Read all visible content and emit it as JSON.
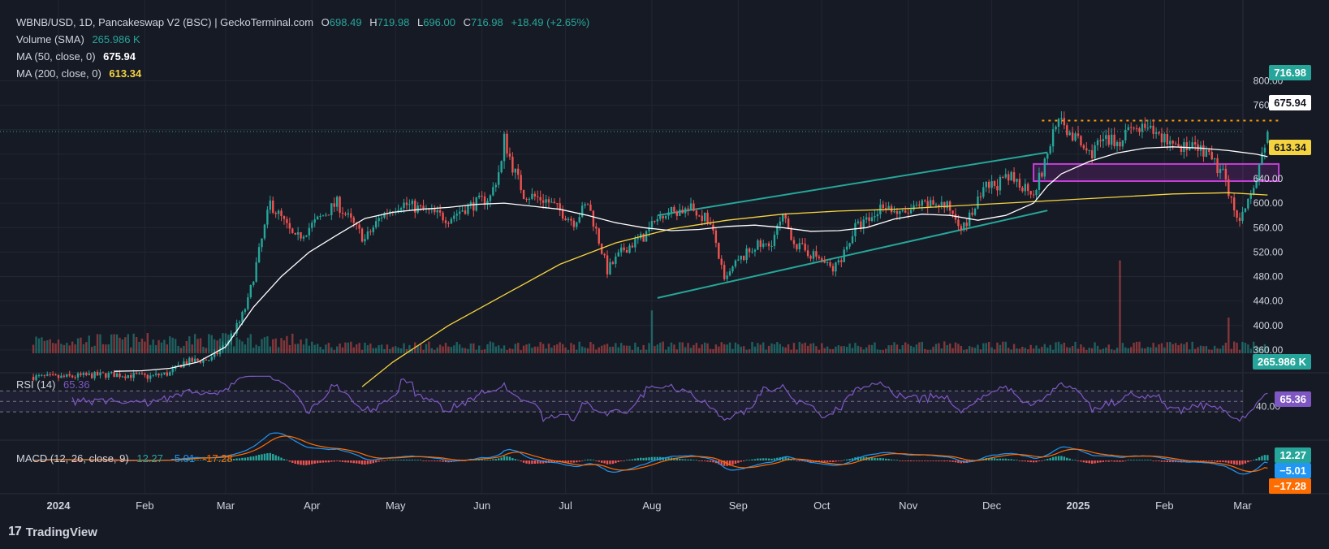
{
  "header": {
    "symbol": "WBNB/USD, 1D, Pancakeswap V2 (BSC) | GeckoTerminal.com",
    "o_label": "O",
    "o": "698.49",
    "h_label": "H",
    "h": "719.98",
    "l_label": "L",
    "l": "696.00",
    "c_label": "C",
    "c": "716.98",
    "change": "+18.49 (+2.65%)"
  },
  "legend": {
    "volume_label": "Volume (SMA)",
    "volume_value": "265.986 K",
    "ma50_label": "MA (50, close, 0)",
    "ma50_value": "675.94",
    "ma200_label": "MA (200, close, 0)",
    "ma200_value": "613.34",
    "rsi_label": "RSI (14)",
    "rsi_value": "65.36",
    "macd_label": "MACD (12, 26, close, 9)",
    "macd_v1": "12.27",
    "macd_v2": "-5.01",
    "macd_v3": "-17.28"
  },
  "tags": {
    "price": "716.98",
    "ma50": "675.94",
    "ma200": "613.34",
    "volume": "265.986 K",
    "rsi": "65.36",
    "macd_hist": "12.27",
    "macd_line": "−5.01",
    "macd_signal": "−17.28"
  },
  "colors": {
    "up": "#26a69a",
    "down": "#ef5350",
    "ma50": "#ffffff",
    "ma200": "#f5d33f",
    "channel": "#26a69a",
    "zone": "#c43fd6",
    "resistance": "#ff9800",
    "rsi": "#7e57c2",
    "macd": "#2196f3",
    "signal": "#ff6d00"
  },
  "footer": {
    "brand": "TradingView"
  },
  "chart_data": {
    "type": "candlestick",
    "title": "WBNB/USD, 1D",
    "x_labels": [
      "2024",
      "Feb",
      "Mar",
      "Apr",
      "May",
      "Jun",
      "Jul",
      "Aug",
      "Sep",
      "Oct",
      "Nov",
      "Dec",
      "2025",
      "Feb",
      "Mar"
    ],
    "x_label_days": [
      0,
      31,
      60,
      91,
      121,
      152,
      182,
      213,
      244,
      274,
      305,
      335,
      366,
      397,
      425
    ],
    "y_ticks": [
      360,
      400,
      440,
      480,
      520,
      560,
      600,
      640,
      680,
      720,
      760,
      800
    ],
    "y_tick_labels": [
      "360.00",
      "400.00",
      "440.00",
      "480.00",
      "520.00",
      "560.00",
      "600.00",
      "640.00",
      "675.94",
      "716.98",
      "760.00",
      "800.00"
    ],
    "ylim": [
      324,
      802
    ],
    "price_path": [
      [
        -9,
        316
      ],
      [
        0,
        315
      ],
      [
        10,
        318
      ],
      [
        20,
        320
      ],
      [
        28,
        318
      ],
      [
        32,
        316
      ],
      [
        40,
        322
      ],
      [
        45,
        340
      ],
      [
        55,
        345
      ],
      [
        60,
        370
      ],
      [
        65,
        405
      ],
      [
        68,
        440
      ],
      [
        72,
        520
      ],
      [
        76,
        600
      ],
      [
        80,
        575
      ],
      [
        85,
        540
      ],
      [
        90,
        560
      ],
      [
        100,
        600
      ],
      [
        110,
        540
      ],
      [
        116,
        580
      ],
      [
        123,
        600
      ],
      [
        130,
        590
      ],
      [
        140,
        575
      ],
      [
        145,
        590
      ],
      [
        150,
        600
      ],
      [
        155,
        610
      ],
      [
        159,
        665
      ],
      [
        160,
        705
      ],
      [
        163,
        660
      ],
      [
        167,
        615
      ],
      [
        175,
        605
      ],
      [
        185,
        570
      ],
      [
        190,
        600
      ],
      [
        193,
        555
      ],
      [
        197,
        490
      ],
      [
        203,
        525
      ],
      [
        210,
        545
      ],
      [
        217,
        585
      ],
      [
        227,
        590
      ],
      [
        233,
        575
      ],
      [
        236,
        535
      ],
      [
        239,
        470
      ],
      [
        243,
        500
      ],
      [
        250,
        530
      ],
      [
        255,
        530
      ],
      [
        260,
        575
      ],
      [
        265,
        530
      ],
      [
        273,
        510
      ],
      [
        278,
        490
      ],
      [
        282,
        520
      ],
      [
        286,
        560
      ],
      [
        292,
        575
      ],
      [
        296,
        600
      ],
      [
        302,
        580
      ],
      [
        310,
        595
      ],
      [
        316,
        600
      ],
      [
        320,
        590
      ],
      [
        325,
        560
      ],
      [
        328,
        585
      ],
      [
        333,
        625
      ],
      [
        342,
        640
      ],
      [
        350,
        620
      ],
      [
        353,
        650
      ],
      [
        355,
        680
      ],
      [
        358,
        735
      ],
      [
        362,
        720
      ],
      [
        366,
        700
      ],
      [
        370,
        680
      ],
      [
        374,
        700
      ],
      [
        380,
        700
      ],
      [
        385,
        720
      ],
      [
        390,
        720
      ],
      [
        395,
        710
      ],
      [
        400,
        700
      ],
      [
        405,
        690
      ],
      [
        410,
        685
      ],
      [
        415,
        665
      ],
      [
        418,
        645
      ],
      [
        421,
        610
      ],
      [
        423,
        570
      ],
      [
        426,
        585
      ],
      [
        430,
        640
      ],
      [
        432,
        680
      ],
      [
        434,
        716.98
      ]
    ],
    "ma50_path": [
      [
        20,
        325
      ],
      [
        30,
        326
      ],
      [
        40,
        330
      ],
      [
        50,
        340
      ],
      [
        60,
        365
      ],
      [
        70,
        430
      ],
      [
        80,
        480
      ],
      [
        90,
        520
      ],
      [
        100,
        548
      ],
      [
        110,
        575
      ],
      [
        120,
        585
      ],
      [
        130,
        590
      ],
      [
        140,
        593
      ],
      [
        150,
        598
      ],
      [
        160,
        600
      ],
      [
        170,
        595
      ],
      [
        180,
        590
      ],
      [
        190,
        580
      ],
      [
        200,
        568
      ],
      [
        210,
        560
      ],
      [
        220,
        555
      ],
      [
        230,
        557
      ],
      [
        240,
        562
      ],
      [
        250,
        564
      ],
      [
        260,
        560
      ],
      [
        270,
        554
      ],
      [
        280,
        555
      ],
      [
        290,
        560
      ],
      [
        300,
        574
      ],
      [
        310,
        582
      ],
      [
        320,
        580
      ],
      [
        330,
        572
      ],
      [
        340,
        580
      ],
      [
        350,
        600
      ],
      [
        355,
        628
      ],
      [
        360,
        648
      ],
      [
        370,
        668
      ],
      [
        380,
        682
      ],
      [
        390,
        690
      ],
      [
        400,
        692
      ],
      [
        410,
        690
      ],
      [
        420,
        686
      ],
      [
        430,
        680
      ],
      [
        434,
        675.94
      ]
    ],
    "ma200_path": [
      [
        109,
        300
      ],
      [
        120,
        340
      ],
      [
        140,
        400
      ],
      [
        160,
        450
      ],
      [
        180,
        500
      ],
      [
        200,
        535
      ],
      [
        220,
        558
      ],
      [
        240,
        572
      ],
      [
        260,
        582
      ],
      [
        280,
        587
      ],
      [
        300,
        590
      ],
      [
        320,
        595
      ],
      [
        340,
        600
      ],
      [
        360,
        605
      ],
      [
        380,
        610
      ],
      [
        400,
        615
      ],
      [
        420,
        617
      ],
      [
        434,
        613.34
      ]
    ],
    "channel_upper": [
      [
        215,
        580
      ],
      [
        355,
        683
      ]
    ],
    "channel_lower": [
      [
        215,
        445
      ],
      [
        355,
        588
      ]
    ],
    "zone": {
      "x0": 350,
      "x1": 438,
      "y0": 636,
      "y1": 664
    },
    "resistance": {
      "x0": 353,
      "x1": 438,
      "y": 735
    },
    "volume_spikes": [
      {
        "day": 381,
        "value": 5.2
      },
      {
        "day": 213,
        "value": 2.4
      },
      {
        "day": 420,
        "value": 2.0
      }
    ],
    "rsi": {
      "range": [
        10,
        100
      ],
      "levels": [
        30,
        50,
        70
      ],
      "ticks": [
        40
      ],
      "last": 65.36
    },
    "macd": {
      "macd": 12.27,
      "line": -5.01,
      "signal": -17.28
    }
  }
}
